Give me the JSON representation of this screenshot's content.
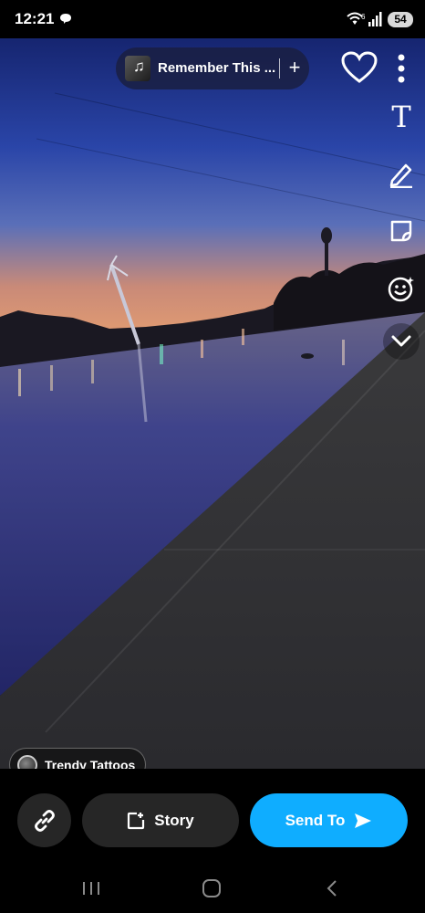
{
  "status_bar": {
    "time": "12:21",
    "wifi_badge": "6",
    "battery": "54",
    "icons": [
      "chat-bubble-icon",
      "wifi-icon",
      "signal-icon",
      "battery-icon"
    ]
  },
  "music": {
    "title": "Remember This ...",
    "add_label": "+",
    "icon": "music-note-icon"
  },
  "rail": {
    "text_tool": "T",
    "icons": [
      "heart-icon",
      "more-vertical-icon",
      "text-icon",
      "pencil-icon",
      "sticker-icon",
      "smiley-icon",
      "chevron-down-icon"
    ]
  },
  "location": {
    "label": "Trendy Tattoos"
  },
  "actions": {
    "story_label": "Story",
    "send_label": "Send To",
    "icons": [
      "link-icon",
      "add-story-icon",
      "send-arrow-icon"
    ]
  },
  "nav": {
    "icons": [
      "recents-icon",
      "home-icon",
      "back-icon"
    ]
  },
  "colors": {
    "send_blue": "#0fadff",
    "pill_dark": "#262626",
    "sky_top": "#1b2a80",
    "horizon_glow": "#e39a6a"
  }
}
